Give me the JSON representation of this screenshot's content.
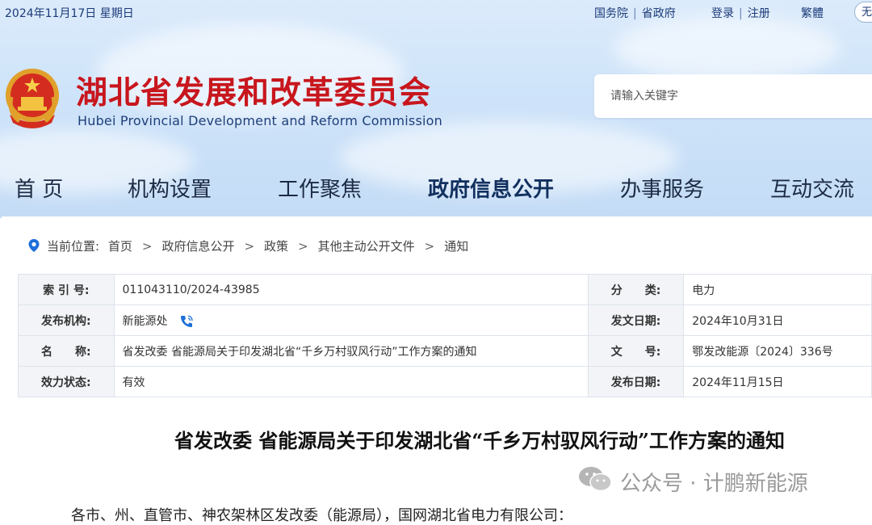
{
  "topbar": {
    "date": "2024年11月17日 星期日",
    "links": [
      "国务院",
      "省政府"
    ],
    "auth": [
      "登录",
      "注册"
    ],
    "traditional": "繁體",
    "accessibility": "无"
  },
  "header": {
    "org_name_cn": "湖北省发展和改革委员会",
    "org_name_en": "Hubei Provincial Development and Reform Commission",
    "search_placeholder": "请输入关键字"
  },
  "nav": {
    "items": [
      "首 页",
      "机构设置",
      "工作聚焦",
      "政府信息公开",
      "办事服务",
      "互动交流"
    ],
    "active_index": 3
  },
  "breadcrumb": {
    "label": "当前位置:",
    "items": [
      "首页",
      "政府信息公开",
      "政策",
      "其他主动公开文件",
      "通知"
    ]
  },
  "meta": {
    "rows": [
      {
        "l1": "索 引 号:",
        "v1": "011043110/2024-43985",
        "l2": "分　　类:",
        "v2": "电力"
      },
      {
        "l1": "发布机构:",
        "v1": "新能源处",
        "l2": "发文日期:",
        "v2": "2024年10月31日"
      },
      {
        "l1": "名　　称:",
        "v1": "省发改委 省能源局关于印发湖北省“千乡万村驭风行动”工作方案的通知",
        "l2": "文　　号:",
        "v2": "鄂发改能源〔2024〕336号"
      },
      {
        "l1": "效力状态:",
        "v1": "有效",
        "l2": "发布日期:",
        "v2": "2024年11月15日"
      }
    ]
  },
  "document": {
    "title": "省发改委 省能源局关于印发湖北省“千乡万村驭风行动”工作方案的通知",
    "salutation": "各市、州、直管市、神农架林区发改委（能源局），国网湖北省电力有限公司："
  },
  "watermark": {
    "text": "公众号 · 计鹏新能源"
  },
  "colors": {
    "brand_red": "#c8161d",
    "nav_text": "#1d2b45",
    "header_bg": "#cfe4fa"
  }
}
